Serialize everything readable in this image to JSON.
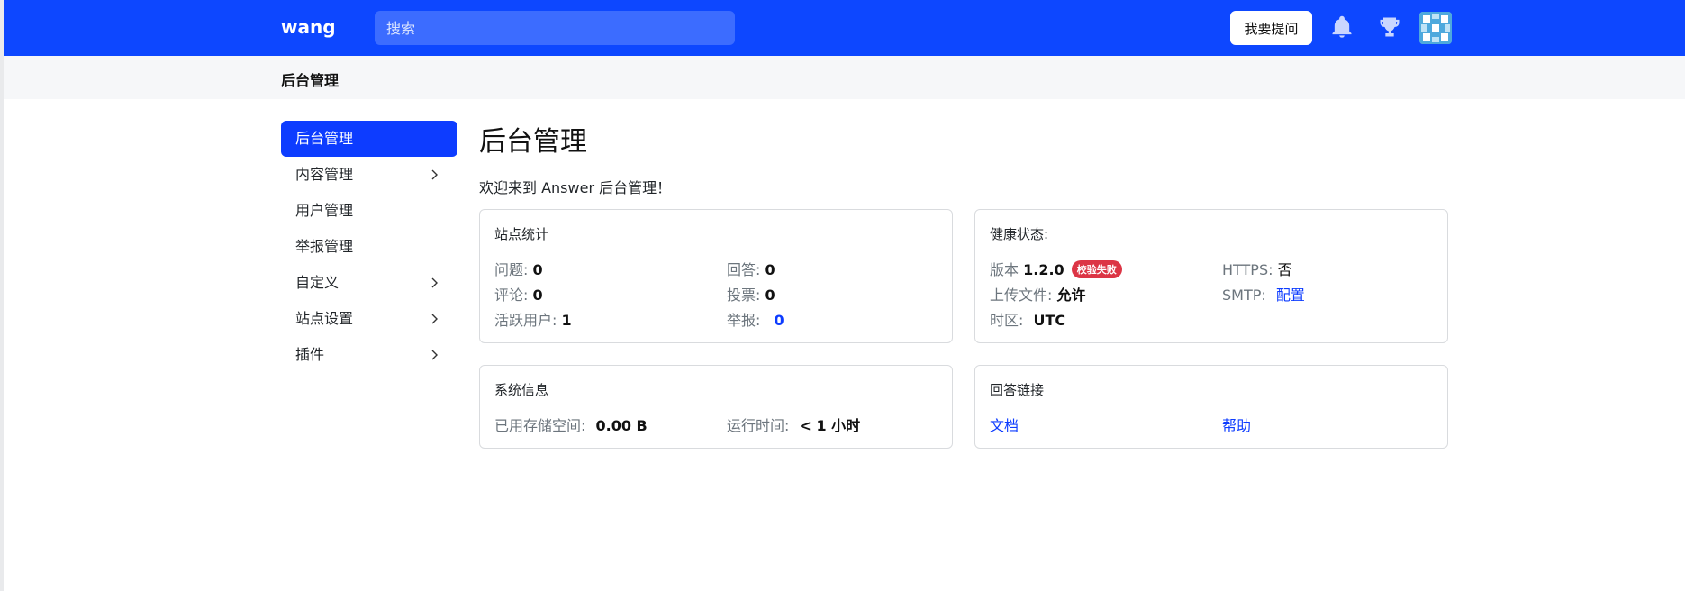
{
  "header": {
    "brand": "wang",
    "search_placeholder": "搜索",
    "ask_label": "我要提问",
    "icons": [
      "bell-icon",
      "trophy-icon",
      "avatar"
    ],
    "colors": {
      "bar": "#0d47ff",
      "search": "#3c6cff"
    }
  },
  "subheader": {
    "title": "后台管理"
  },
  "sidebar": {
    "items": [
      {
        "label": "后台管理",
        "active": true,
        "expandable": false
      },
      {
        "label": "内容管理",
        "expandable": true
      },
      {
        "label": "用户管理",
        "expandable": false
      },
      {
        "label": "举报管理",
        "expandable": false
      },
      {
        "label": "自定义",
        "expandable": true
      },
      {
        "label": "站点设置",
        "expandable": true
      },
      {
        "label": "插件",
        "expandable": true
      }
    ]
  },
  "main": {
    "title": "后台管理",
    "welcome": "欢迎来到 Answer 后台管理！",
    "site_stats": {
      "title": "站点统计",
      "questions_label": "问题:",
      "questions_value": "0",
      "answers_label": "回答:",
      "answers_value": "0",
      "comments_label": "评论:",
      "comments_value": "0",
      "votes_label": "投票:",
      "votes_value": "0",
      "active_users_label": "活跃用户:",
      "active_users_value": "1",
      "reports_label": "举报:",
      "reports_value": "0"
    },
    "health": {
      "title": "健康状态:",
      "version_label": "版本",
      "version_value": "1.2.0",
      "version_badge": "校验失败",
      "https_label": "HTTPS:",
      "https_value": "否",
      "upload_label": "上传文件:",
      "upload_value": "允许",
      "smtp_label": "SMTP:",
      "smtp_value": "配置",
      "timezone_label": "时区:",
      "timezone_value": "UTC"
    },
    "system": {
      "title": "系统信息",
      "storage_label": "已用存储空间:",
      "storage_value": "0.00 B",
      "uptime_label": "运行时间:",
      "uptime_value": "< 1 小时"
    },
    "links": {
      "title": "回答链接",
      "docs": "文档",
      "help": "帮助"
    }
  }
}
